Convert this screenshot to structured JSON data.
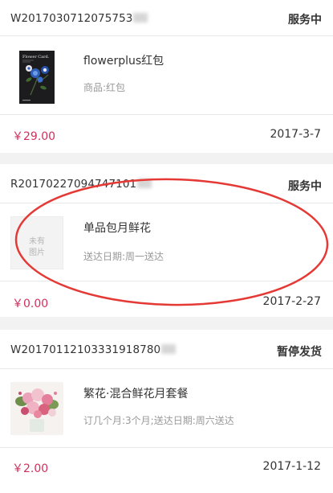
{
  "orders": [
    {
      "order_id": "W2017030712075753",
      "status": "服务中",
      "product_name": "flowerplus红包",
      "product_desc": "商品:红包",
      "card_title": "Flower Card.",
      "price": "￥29.00",
      "date": "2017-3-7"
    },
    {
      "order_id": "R20170227094747101",
      "status": "服务中",
      "product_name": "单品包月鲜花",
      "product_desc": "送达日期:周一送达",
      "no_image_line1": "未有",
      "no_image_line2": "图片",
      "price": "￥0.00",
      "date": "2017-2-27"
    },
    {
      "order_id": "W20170112103331918780",
      "status": "暂停发货",
      "product_name": "繁花·混合鲜花月套餐",
      "product_desc": "订几个月:3个月;送达日期:周六送达",
      "price": "￥2.00",
      "date": "2017-1-12"
    }
  ],
  "colors": {
    "price": "#d0305b",
    "annotation": "#e53935",
    "background": "#f2f2f2"
  }
}
